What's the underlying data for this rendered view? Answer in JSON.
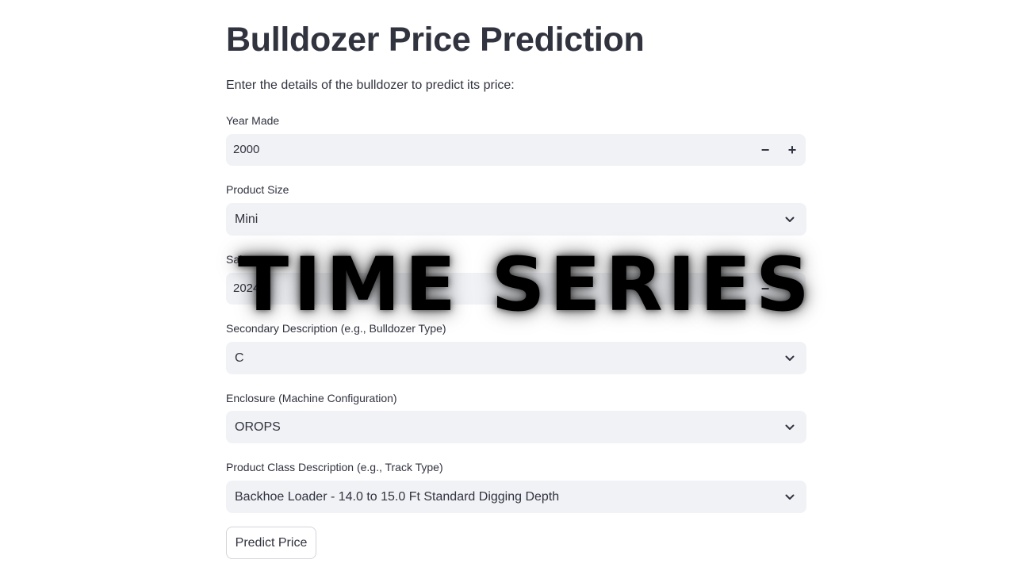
{
  "page": {
    "title": "Bulldozer Price Prediction",
    "intro": "Enter the details of the bulldozer to predict its price:"
  },
  "fields": {
    "year_made": {
      "label": "Year Made",
      "value": "2000",
      "minus": "−",
      "plus": "+"
    },
    "product_size": {
      "label": "Product Size",
      "value": "Mini"
    },
    "sale_year": {
      "label": "Sale",
      "value": "2024",
      "minus": "−",
      "plus": "+"
    },
    "secondary_desc": {
      "label": "Secondary Description (e.g., Bulldozer Type)",
      "value": "C"
    },
    "enclosure": {
      "label": "Enclosure (Machine Configuration)",
      "value": "OROPS"
    },
    "product_class": {
      "label": "Product Class Description (e.g., Track Type)",
      "value": "Backhoe Loader - 14.0 to 15.0 Ft Standard Digging Depth"
    }
  },
  "actions": {
    "predict_label": "Predict Price"
  },
  "overlay": {
    "text": "TIME SERIES"
  },
  "icons": {
    "dropdown": "chevron-down-icon",
    "increment": "plus-icon",
    "decrement": "minus-icon"
  },
  "colors": {
    "field_bg": "#f0f2f6",
    "text": "#31333f",
    "button_border": "#d3d5da"
  }
}
